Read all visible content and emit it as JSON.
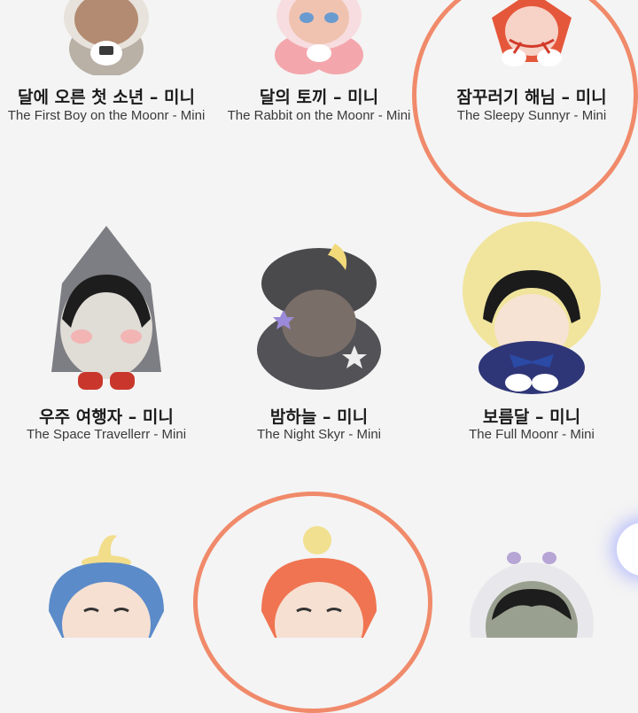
{
  "products": [
    {
      "ko": "달에 오른 첫 소년 – 미니",
      "en": "The First Boy on the Moonr - Mini",
      "icon": "first-boy-figure"
    },
    {
      "ko": "달의 토끼 – 미니",
      "en": "The Rabbit on the Moonr - Mini",
      "icon": "rabbit-figure"
    },
    {
      "ko": "잠꾸러기 해님 – 미니",
      "en": "The Sleepy Sunnyr - Mini",
      "icon": "sleepy-sun-figure"
    },
    {
      "ko": "우주 여행자 – 미니",
      "en": "The Space Travellerr - Mini",
      "icon": "rocket-figure"
    },
    {
      "ko": "밤하늘 – 미니",
      "en": "The Night Skyr - Mini",
      "icon": "night-sky-figure"
    },
    {
      "ko": "보름달 – 미니",
      "en": "The Full Moonr - Mini",
      "icon": "full-moon-figure"
    },
    {
      "icon": "moon-hat-figure"
    },
    {
      "icon": "sun-hat-figure"
    },
    {
      "icon": "astronaut-figure"
    }
  ],
  "colors": {
    "annotation": "#f08a6a",
    "background": "#f4f4f4"
  }
}
